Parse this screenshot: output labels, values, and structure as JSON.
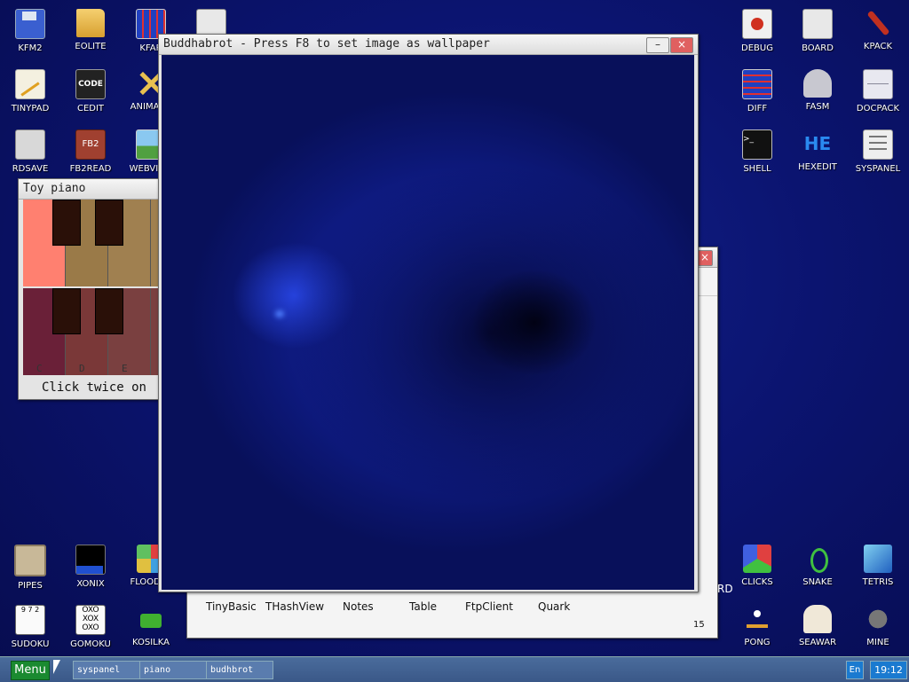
{
  "desktop_icons": [
    {
      "label": "KFM2"
    },
    {
      "label": "EOLITE"
    },
    {
      "label": "KFAR"
    },
    {
      "label": ""
    },
    {
      "label": "TINYPAD"
    },
    {
      "label": "CEDIT"
    },
    {
      "label": "ANIMAGE"
    },
    {
      "label": "RDSAVE"
    },
    {
      "label": "FB2READ"
    },
    {
      "label": "WEBVIEW"
    },
    {
      "label": "DEBUG"
    },
    {
      "label": "BOARD"
    },
    {
      "label": "KPACK"
    },
    {
      "label": "DIFF"
    },
    {
      "label": "FASM"
    },
    {
      "label": "DOCPACK"
    },
    {
      "label": "SHELL"
    },
    {
      "label": "HEXEDIT"
    },
    {
      "label": "SYSPANEL"
    },
    {
      "label": "PIPES"
    },
    {
      "label": "XONIX"
    },
    {
      "label": "FLOOD-IT"
    },
    {
      "label": "SUDOKU"
    },
    {
      "label": "GOMOKU"
    },
    {
      "label": "KOSILKA"
    },
    {
      "label": "CLICKS"
    },
    {
      "label": "SNAKE"
    },
    {
      "label": "TETRIS"
    },
    {
      "label": "PONG"
    },
    {
      "label": "SEAWAR"
    },
    {
      "label": "MINE"
    }
  ],
  "icon_glyphs": {
    "cedit": "CODE",
    "fb2": "FB2",
    "shell": ">_",
    "hexedit": "HE",
    "sudoku": "9 7 2",
    "gomoku": "OXO XOX OXO"
  },
  "piano": {
    "title": "Toy piano",
    "notes": [
      "C",
      "D",
      "E"
    ],
    "hint": "Click twice on"
  },
  "buddhabrot": {
    "title": "Buddhabrot - Press F8 to set image as wallpaper"
  },
  "background_window": {
    "apps": [
      "TinyBasic",
      "THashView",
      "Notes",
      "Table",
      "FtpClient",
      "Quark"
    ],
    "partial_label": "RD",
    "number": "15"
  },
  "taskbar": {
    "menu": "Menu",
    "tasks": [
      "syspanel",
      "piano",
      "budhbrot"
    ],
    "lang": "En",
    "clock": "19:12"
  },
  "colors": {
    "desktop": "#0b1470",
    "taskbar": "#3a5888",
    "menu": "#1a8a30",
    "clock": "#1a7ad0"
  }
}
